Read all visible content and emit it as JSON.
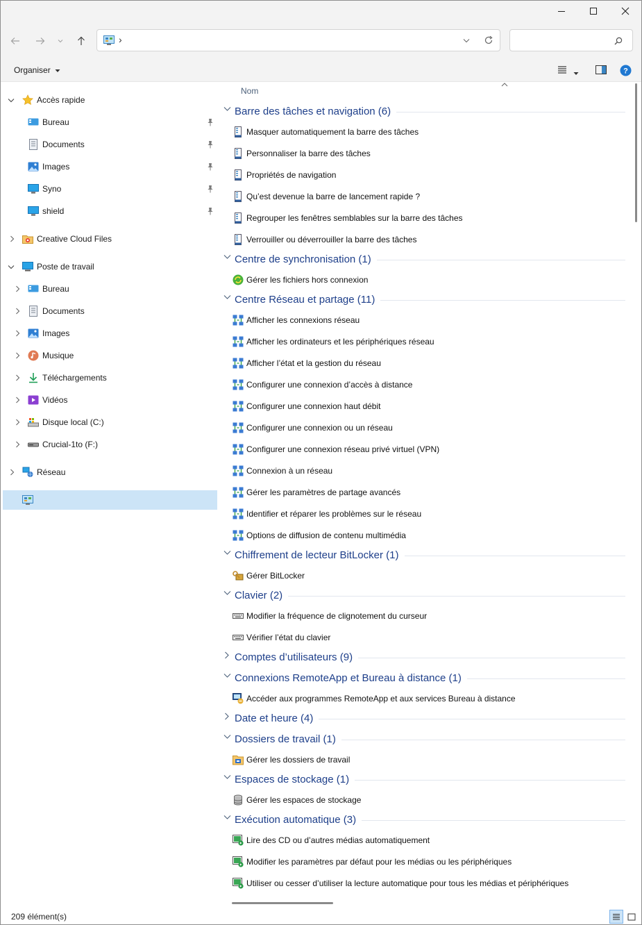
{
  "window": {
    "controls": {
      "minimize": "—",
      "maximize": "☐",
      "close": "✕"
    }
  },
  "address": {
    "path_separator": "›",
    "search_placeholder": ""
  },
  "toolbar": {
    "organiser_label": "Organiser"
  },
  "sidebar": {
    "items": [
      {
        "label": "Accès rapide",
        "icon": "star-icon",
        "indent": 0,
        "chevron": "down",
        "y": 0
      },
      {
        "label": "Bureau",
        "icon": "desktop-icon",
        "indent": 1,
        "chevron": "none",
        "pinned": true
      },
      {
        "label": "Documents",
        "icon": "documents-icon",
        "indent": 1,
        "chevron": "none",
        "pinned": true
      },
      {
        "label": "Images",
        "icon": "pictures-icon",
        "indent": 1,
        "chevron": "none",
        "pinned": true
      },
      {
        "label": "Syno",
        "icon": "monitor-icon",
        "indent": 1,
        "chevron": "none",
        "pinned": true
      },
      {
        "label": "shield",
        "icon": "monitor-icon",
        "indent": 1,
        "chevron": "none",
        "pinned": true
      },
      {
        "label": "Creative Cloud Files",
        "icon": "creative-cloud-folder-icon",
        "indent": 0,
        "chevron": "right"
      },
      {
        "label": "Poste de travail",
        "icon": "computer-icon",
        "indent": 0,
        "chevron": "down"
      },
      {
        "label": "Bureau",
        "icon": "desktop-icon",
        "indent": 1,
        "chevron": "right"
      },
      {
        "label": "Documents",
        "icon": "documents-icon",
        "indent": 1,
        "chevron": "right"
      },
      {
        "label": "Images",
        "icon": "pictures-icon",
        "indent": 1,
        "chevron": "right"
      },
      {
        "label": "Musique",
        "icon": "music-icon",
        "indent": 1,
        "chevron": "right"
      },
      {
        "label": "Téléchargements",
        "icon": "download-icon",
        "indent": 1,
        "chevron": "right"
      },
      {
        "label": "Vidéos",
        "icon": "videos-icon",
        "indent": 1,
        "chevron": "right"
      },
      {
        "label": "Disque local (C:)",
        "icon": "local-disk-icon",
        "indent": 1,
        "chevron": "right"
      },
      {
        "label": "Crucial-1to (F:)",
        "icon": "drive-icon",
        "indent": 1,
        "chevron": "right"
      },
      {
        "label": "Réseau",
        "icon": "network-icon",
        "indent": 0,
        "chevron": "right"
      },
      {
        "label": "",
        "icon": "control-panel-icon",
        "indent": 0,
        "chevron": "none",
        "selected": true
      }
    ]
  },
  "list": {
    "column_name": "Nom",
    "groups": [
      {
        "title": "Barre des tâches et navigation (6)",
        "expanded": true,
        "icon": "taskbar-icon",
        "items": [
          "Masquer automatiquement la barre des tâches",
          "Personnaliser la barre des tâches",
          "Propriétés de navigation",
          "Qu’est devenue la barre de lancement rapide ?",
          "Regrouper les fenêtres semblables sur la barre des tâches",
          "Verrouiller ou déverrouiller la barre des tâches"
        ]
      },
      {
        "title": "Centre de synchronisation (1)",
        "expanded": true,
        "icon": "sync-icon",
        "items": [
          "Gérer les fichiers hors connexion"
        ]
      },
      {
        "title": "Centre Réseau et partage (11)",
        "expanded": true,
        "icon": "network-center-icon",
        "items": [
          "Afficher les connexions réseau",
          "Afficher les ordinateurs et les périphériques réseau",
          "Afficher l’état et la gestion du réseau",
          "Configurer une connexion d’accès à distance",
          "Configurer une connexion haut débit",
          "Configurer une connexion ou un réseau",
          "Configurer une connexion réseau privé virtuel (VPN)",
          "Connexion à un réseau",
          "Gérer les paramètres de partage avancés",
          "Identifier et réparer les problèmes sur le réseau",
          "Options de diffusion de contenu multimédia"
        ]
      },
      {
        "title": "Chiffrement de lecteur BitLocker (1)",
        "expanded": true,
        "icon": "bitlocker-icon",
        "items": [
          "Gérer BitLocker"
        ]
      },
      {
        "title": "Clavier (2)",
        "expanded": true,
        "icon": "keyboard-icon",
        "items": [
          "Modifier la fréquence de clignotement du curseur",
          "Vérifier l’état du clavier"
        ]
      },
      {
        "title": "Comptes d’utilisateurs (9)",
        "expanded": false,
        "icon": "users-icon",
        "items": []
      },
      {
        "title": "Connexions RemoteApp et Bureau à distance (1)",
        "expanded": true,
        "icon": "remoteapp-icon",
        "items": [
          "Accéder aux programmes RemoteApp et aux services Bureau à distance"
        ]
      },
      {
        "title": "Date et heure (4)",
        "expanded": false,
        "icon": "clock-icon",
        "items": []
      },
      {
        "title": "Dossiers de travail (1)",
        "expanded": true,
        "icon": "work-folders-icon",
        "items": [
          "Gérer les dossiers de travail"
        ]
      },
      {
        "title": "Espaces de stockage (1)",
        "expanded": true,
        "icon": "storage-spaces-icon",
        "items": [
          "Gérer les espaces de stockage"
        ]
      },
      {
        "title": "Exécution automatique (3)",
        "expanded": true,
        "icon": "autoplay-icon",
        "items": [
          "Lire des CD ou d’autres médias automatiquement",
          "Modifier les paramètres par défaut pour les médias ou les périphériques",
          "Utiliser ou cesser d’utiliser la lecture automatique pour tous les médias et périphériques"
        ]
      }
    ]
  },
  "status": {
    "count": "209 élément(s)"
  },
  "colors": {
    "group_title": "#1e3f8a",
    "selection": "#cce4f7",
    "accent": "#0067c0"
  }
}
